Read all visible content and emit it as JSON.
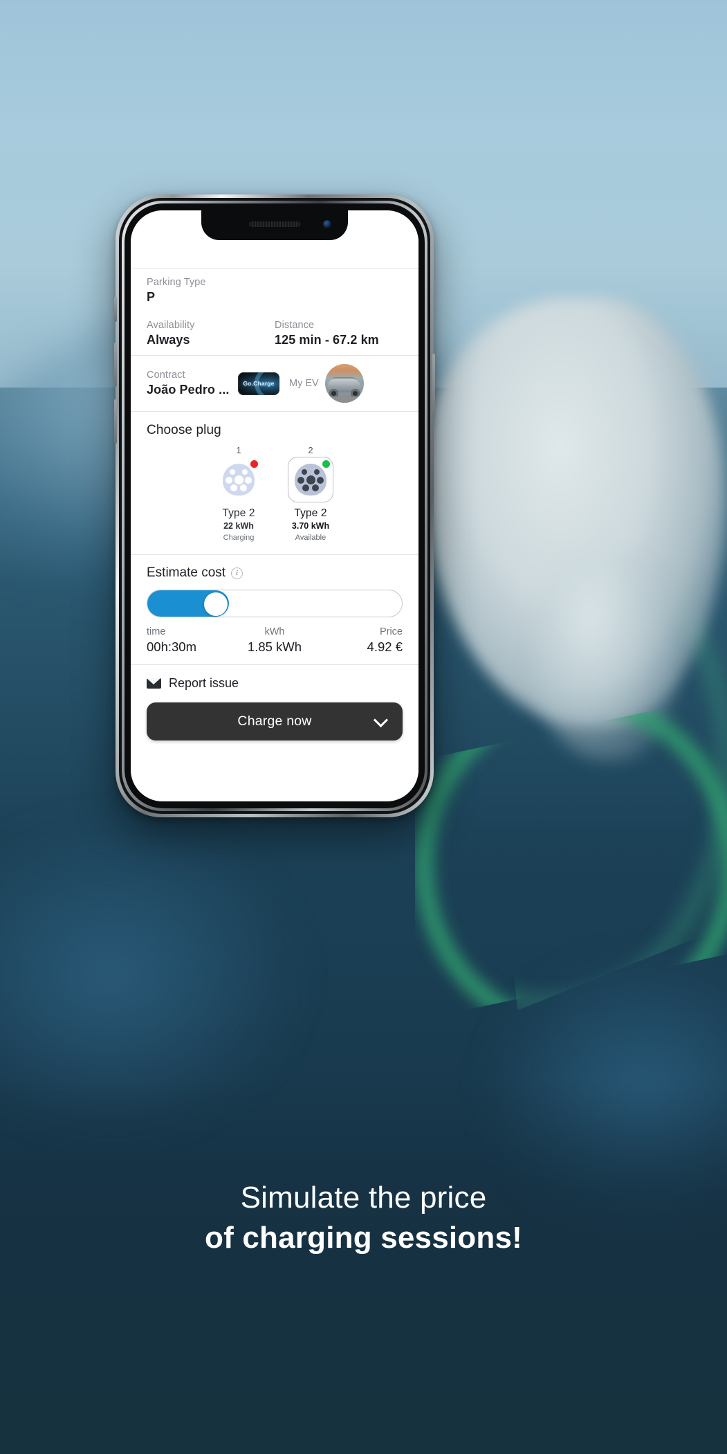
{
  "background": {
    "sky_color": "#a8cbdd",
    "deep_color": "#1c4258",
    "cable_color": "#30a06e"
  },
  "phone": {
    "notch": {
      "speaker_name": "earpiece-speaker",
      "camera_name": "front-camera"
    }
  },
  "app": {
    "parking": {
      "label": "Parking Type",
      "value": "P"
    },
    "availability": {
      "label": "Availability",
      "value": "Always"
    },
    "distance": {
      "label": "Distance",
      "value": "125 min - 67.2 km"
    },
    "contract": {
      "label": "Contract",
      "value": "João Pedro ...",
      "logo_text": "Go.Charge"
    },
    "my_ev": {
      "label": "My EV"
    },
    "choose_plug": {
      "title": "Choose plug",
      "plugs": [
        {
          "number": "1",
          "type": "Type 2",
          "power": "22 kWh",
          "status": "Charging",
          "status_color": "#ee2222",
          "selected": false
        },
        {
          "number": "2",
          "type": "Type 2",
          "power": "3.70 kWh",
          "status": "Available",
          "status_color": "#16c04a",
          "selected": true
        }
      ]
    },
    "estimate": {
      "title": "Estimate cost",
      "info_glyph": "i",
      "slider_percent": 32,
      "accent_color": "#1a8fd1",
      "stats": [
        {
          "label": "time",
          "value": "00h:30m"
        },
        {
          "label": "kWh",
          "value": "1.85 kWh"
        },
        {
          "label": "Price",
          "value": "4.92 €"
        }
      ]
    },
    "report_issue": {
      "label": "Report issue"
    },
    "cta": {
      "label": "Charge now"
    }
  },
  "caption": {
    "line1": "Simulate the price",
    "line2": "of charging sessions!"
  }
}
